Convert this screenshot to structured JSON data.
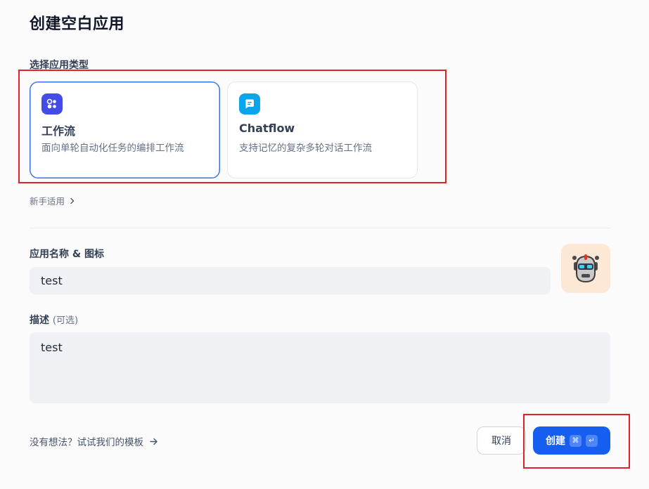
{
  "page": {
    "title": "创建空白应用"
  },
  "app_type": {
    "label": "选择应用类型",
    "cards": [
      {
        "title": "工作流",
        "description": "面向单轮自动化任务的编排工作流",
        "icon": "workflow-icon",
        "icon_color": "#444ce7",
        "selected": true
      },
      {
        "title": "Chatflow",
        "description": "支持记忆的复杂多轮对话工作流",
        "icon": "chatflow-icon",
        "icon_color": "#0ba5ec",
        "selected": false
      }
    ]
  },
  "beginner_link": {
    "label": "新手适用"
  },
  "name_section": {
    "label": "应用名称 & 图标",
    "value": "test",
    "avatar": "robot-icon"
  },
  "description_section": {
    "label": "描述",
    "optional": "(可选)",
    "value": "test"
  },
  "footer": {
    "template_link": "没有想法？试试我们的模板",
    "cancel_label": "取消",
    "create_label": "创建",
    "shortcut_keys": [
      "⌘",
      "↵"
    ]
  },
  "colors": {
    "primary": "#155eef",
    "highlight": "#e2222b"
  }
}
